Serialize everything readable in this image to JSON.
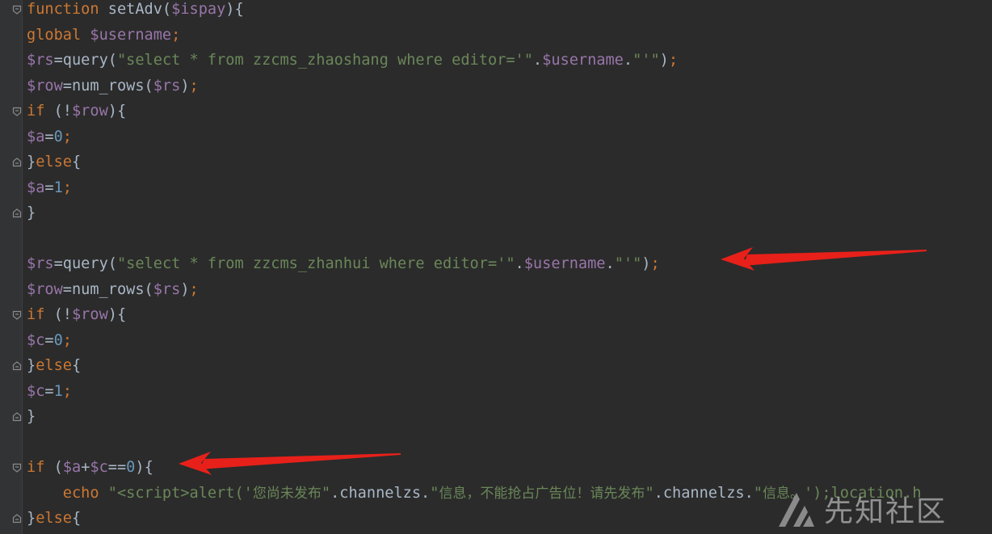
{
  "editor": {
    "theme_colors": {
      "background": "#2b2b2b",
      "keyword": "#cc7832",
      "variable": "#9876aa",
      "string": "#6a8759",
      "number": "#6897bb",
      "plain": "#a9b7c6",
      "arrow": "#e8201a"
    },
    "lines": [
      [
        {
          "t": "kw",
          "v": "function "
        },
        {
          "t": "fn",
          "v": "setAdv"
        },
        {
          "t": "plain",
          "v": "("
        },
        {
          "t": "var",
          "v": "$ispay"
        },
        {
          "t": "plain",
          "v": "){"
        }
      ],
      [
        {
          "t": "kw",
          "v": "global "
        },
        {
          "t": "var",
          "v": "$username"
        },
        {
          "t": "kw",
          "v": ";"
        }
      ],
      [
        {
          "t": "var",
          "v": "$rs"
        },
        {
          "t": "plain",
          "v": "=query("
        },
        {
          "t": "str",
          "v": "\"select * from zzcms_zhaoshang where editor='\""
        },
        {
          "t": "plain",
          "v": "."
        },
        {
          "t": "var",
          "v": "$username"
        },
        {
          "t": "plain",
          "v": "."
        },
        {
          "t": "str",
          "v": "\"'\""
        },
        {
          "t": "plain",
          "v": ")"
        },
        {
          "t": "kw",
          "v": ";"
        }
      ],
      [
        {
          "t": "var",
          "v": "$row"
        },
        {
          "t": "plain",
          "v": "=num_rows("
        },
        {
          "t": "var",
          "v": "$rs"
        },
        {
          "t": "plain",
          "v": ")"
        },
        {
          "t": "kw",
          "v": ";"
        }
      ],
      [
        {
          "t": "kw",
          "v": "if "
        },
        {
          "t": "plain",
          "v": "(!"
        },
        {
          "t": "var",
          "v": "$row"
        },
        {
          "t": "plain",
          "v": "){"
        }
      ],
      [
        {
          "t": "var",
          "v": "$a"
        },
        {
          "t": "plain",
          "v": "="
        },
        {
          "t": "num",
          "v": "0"
        },
        {
          "t": "kw",
          "v": ";"
        }
      ],
      [
        {
          "t": "plain",
          "v": "}"
        },
        {
          "t": "kw",
          "v": "else"
        },
        {
          "t": "plain",
          "v": "{"
        }
      ],
      [
        {
          "t": "var",
          "v": "$a"
        },
        {
          "t": "plain",
          "v": "="
        },
        {
          "t": "num",
          "v": "1"
        },
        {
          "t": "kw",
          "v": ";"
        }
      ],
      [
        {
          "t": "plain",
          "v": "}"
        }
      ],
      [],
      [
        {
          "t": "var",
          "v": "$rs"
        },
        {
          "t": "plain",
          "v": "=query("
        },
        {
          "t": "str",
          "v": "\"select * from zzcms_zhanhui where editor='\""
        },
        {
          "t": "plain",
          "v": "."
        },
        {
          "t": "var",
          "v": "$username"
        },
        {
          "t": "plain",
          "v": "."
        },
        {
          "t": "str",
          "v": "\"'\""
        },
        {
          "t": "plain",
          "v": ")"
        },
        {
          "t": "kw",
          "v": ";"
        }
      ],
      [
        {
          "t": "var",
          "v": "$row"
        },
        {
          "t": "plain",
          "v": "=num_rows("
        },
        {
          "t": "var",
          "v": "$rs"
        },
        {
          "t": "plain",
          "v": ")"
        },
        {
          "t": "kw",
          "v": ";"
        }
      ],
      [
        {
          "t": "kw",
          "v": "if "
        },
        {
          "t": "plain",
          "v": "(!"
        },
        {
          "t": "var",
          "v": "$row"
        },
        {
          "t": "plain",
          "v": "){"
        }
      ],
      [
        {
          "t": "var",
          "v": "$c"
        },
        {
          "t": "plain",
          "v": "="
        },
        {
          "t": "num",
          "v": "0"
        },
        {
          "t": "kw",
          "v": ";"
        }
      ],
      [
        {
          "t": "plain",
          "v": "}"
        },
        {
          "t": "kw",
          "v": "else"
        },
        {
          "t": "plain",
          "v": "{"
        }
      ],
      [
        {
          "t": "var",
          "v": "$c"
        },
        {
          "t": "plain",
          "v": "="
        },
        {
          "t": "num",
          "v": "1"
        },
        {
          "t": "kw",
          "v": ";"
        }
      ],
      [
        {
          "t": "plain",
          "v": "}"
        }
      ],
      [],
      [
        {
          "t": "kw",
          "v": "if "
        },
        {
          "t": "plain",
          "v": "("
        },
        {
          "t": "var",
          "v": "$a"
        },
        {
          "t": "plain",
          "v": "+"
        },
        {
          "t": "var",
          "v": "$c"
        },
        {
          "t": "plain",
          "v": "=="
        },
        {
          "t": "num",
          "v": "0"
        },
        {
          "t": "plain",
          "v": "){"
        }
      ],
      [
        {
          "t": "plain",
          "v": "    "
        },
        {
          "t": "kw",
          "v": "echo "
        },
        {
          "t": "str",
          "v": "\"<script>alert('"
        },
        {
          "t": "str-cjk",
          "v": "您尚未发布"
        },
        {
          "t": "str",
          "v": "\""
        },
        {
          "t": "plain",
          "v": ".channelzs."
        },
        {
          "t": "str",
          "v": "\""
        },
        {
          "t": "str-cjk",
          "v": "信息，不能抢占广告位！请先发布"
        },
        {
          "t": "str",
          "v": "\""
        },
        {
          "t": "plain",
          "v": ".channelzs."
        },
        {
          "t": "str",
          "v": "\""
        },
        {
          "t": "str-cjk",
          "v": "信息。"
        },
        {
          "t": "str",
          "v": "');location.h"
        }
      ],
      [
        {
          "t": "plain",
          "v": "}"
        },
        {
          "t": "kw",
          "v": "else"
        },
        {
          "t": "plain",
          "v": "{"
        }
      ]
    ],
    "fold_markers": [
      {
        "line": 0,
        "kind": "open"
      },
      {
        "line": 4,
        "kind": "open"
      },
      {
        "line": 6,
        "kind": "close"
      },
      {
        "line": 8,
        "kind": "close"
      },
      {
        "line": 12,
        "kind": "open"
      },
      {
        "line": 14,
        "kind": "close"
      },
      {
        "line": 16,
        "kind": "close"
      },
      {
        "line": 18,
        "kind": "open"
      },
      {
        "line": 20,
        "kind": "close"
      }
    ]
  },
  "annotations": {
    "arrows": [
      {
        "name": "arrow-to-zhanhui-query",
        "target_line": 10
      },
      {
        "name": "arrow-to-if-condition",
        "target_line": 18
      }
    ]
  },
  "watermark": {
    "text": "先知社区",
    "logo_icon": "xianzhi-logo-icon"
  }
}
